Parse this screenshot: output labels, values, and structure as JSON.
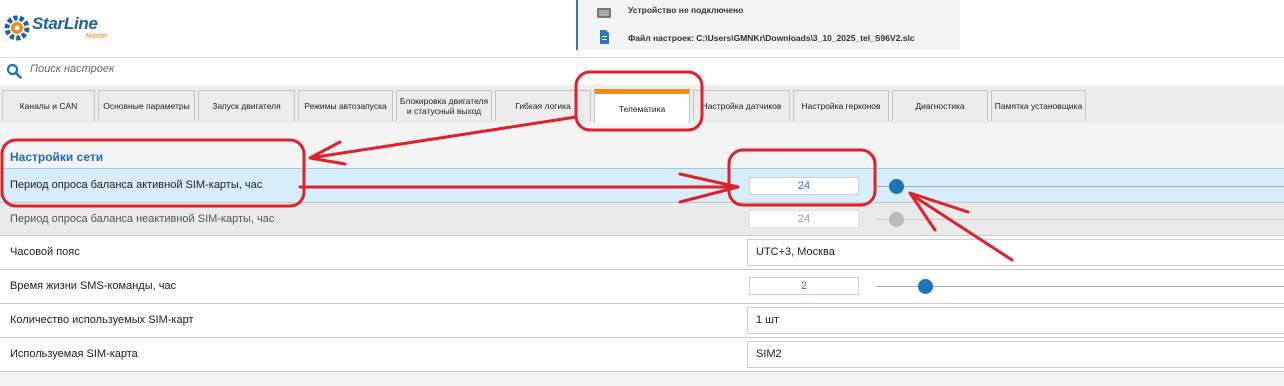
{
  "app": {
    "logo_text": "StarLine",
    "logo_sub": "Master"
  },
  "status": {
    "device_status": "Устройство не подключено",
    "settings_file": "Файл настроек: C:\\Users\\GMNKr\\Downloads\\3_10_2025_tel_S96V2.slc"
  },
  "search": {
    "placeholder": "Поиск настроек"
  },
  "tabs": [
    {
      "label": "Каналы и CAN"
    },
    {
      "label": "Основные параметры"
    },
    {
      "label": "Запуск двигателя"
    },
    {
      "label": "Режимы автозапуска"
    },
    {
      "label": "Блокировка двигателя и статусный выход"
    },
    {
      "label": "Гибкая логика"
    },
    {
      "label": "Телематика",
      "active": true
    },
    {
      "label": "Настройка датчиков"
    },
    {
      "label": "Настройка герконов"
    },
    {
      "label": "Диагностика"
    },
    {
      "label": "Памятка установщика"
    }
  ],
  "section": {
    "title": "Настройки сети"
  },
  "rows": [
    {
      "label": "Период опроса баланса активной SIM-карты, час",
      "value": "24",
      "slider_fraction": 0.05,
      "state": "active"
    },
    {
      "label": "Период опроса баланса неактивной SIM-карты, час",
      "value": "24",
      "slider_fraction": 0.05,
      "state": "disabled"
    },
    {
      "label": "Часовой пояс",
      "value": "UTC+3, Москва"
    },
    {
      "label": "Время жизни SMS-команды, час",
      "value": "2",
      "slider_fraction": 0.12
    },
    {
      "label": "Количество используемых SIM-карт",
      "value": "1 шт"
    },
    {
      "label": "Используемая SIM-карта",
      "value": "SIM2"
    }
  ],
  "colors": {
    "accent": "#1d74bd",
    "tab_active": "#f08a1c",
    "annotation": "#e0202a"
  }
}
